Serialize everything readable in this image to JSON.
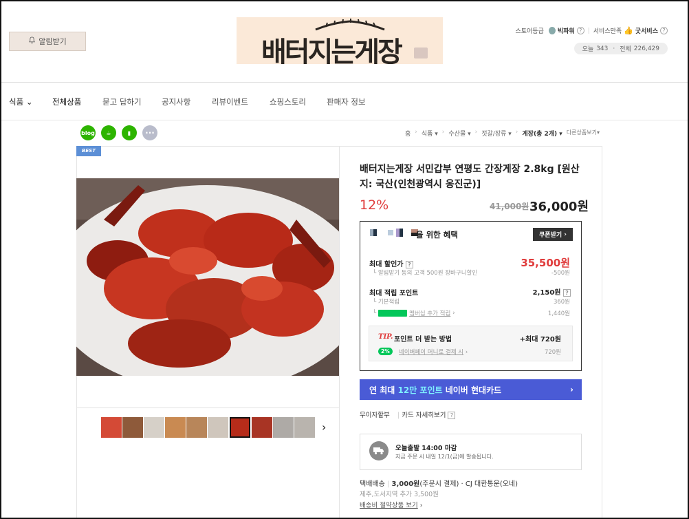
{
  "header": {
    "alarm_label": "알림받기",
    "logo_text": "배터지는게장",
    "store_grade_label": "스토어등급",
    "store_grade_value": "빅파워",
    "service_label": "서비스만족",
    "service_value": "굿서비스",
    "today_label": "오늘",
    "today_value": "343",
    "total_label": "전체",
    "total_value": "226,429"
  },
  "nav": {
    "items": [
      "식품",
      "전체상품",
      "묻고 답하기",
      "공지사항",
      "리뷰이벤트",
      "쇼핑스토리",
      "판매자 정보"
    ]
  },
  "breadcrumb": {
    "home": "홈",
    "items": [
      "식품",
      "수산물",
      "젓갈/장류",
      "게장(총 2개)",
      "다른상품보기"
    ]
  },
  "share": {
    "more": "···"
  },
  "badge": {
    "best": "BEST"
  },
  "product": {
    "title": "배터지는게장 서민갑부 연평도 간장게장 2.8kg [원산지: 국산(인천광역시 옹진군)]",
    "discount": "12%",
    "original_price": "41,000원",
    "price": "36,000원"
  },
  "benefit": {
    "header": "을 위한 혜택",
    "coupon_button": "쿠폰받기",
    "max_discount_label": "최대 할인가",
    "max_discount_value": "35,500원",
    "max_discount_sub": "알림받기 동의 고객 500원 장바구니할인",
    "max_discount_sub_value": "-500원",
    "max_point_label": "최대 적립 포인트",
    "max_point_value": "2,150원",
    "basic_label": "기본적립",
    "basic_value": "360원",
    "membership_label": "멤버십 추가 적립",
    "membership_value": "1,440원",
    "tip_tag": "TIP.",
    "tip_text": "포인트 더 받는 방법",
    "tip_value": "+최대 720원",
    "naverpay_badge": "2%",
    "naverpay_label": "네이버페이 머니로 결제 시",
    "naverpay_value": "720원"
  },
  "card_banner": {
    "prefix": "연 최대 ",
    "highlight": "12만 포인트",
    "suffix": " 네이버 현대카드",
    "arrow": "›"
  },
  "installment": {
    "label": "무이자할부",
    "detail": "카드 자세히보기"
  },
  "shipping": {
    "today_title": "오늘출발 14:00 마감",
    "today_sub": "지금 주문 시 내일 12/1(금)에 발송됩니다.",
    "method": "택배배송",
    "fee": "3,000원",
    "fee_note": "(주문시 결제)",
    "carrier": "CJ 대한통운(오네)",
    "extra": "제주,도서지역 추가 3,500원",
    "saving_link": "배송비 절약상품 보기"
  },
  "colors": {
    "accent_red": "#e03c3c",
    "card_blue": "#4a5bd6",
    "card_highlight": "#7ff0ff",
    "naver_green": "#03c75a",
    "best_blue": "#5c8fd6"
  }
}
